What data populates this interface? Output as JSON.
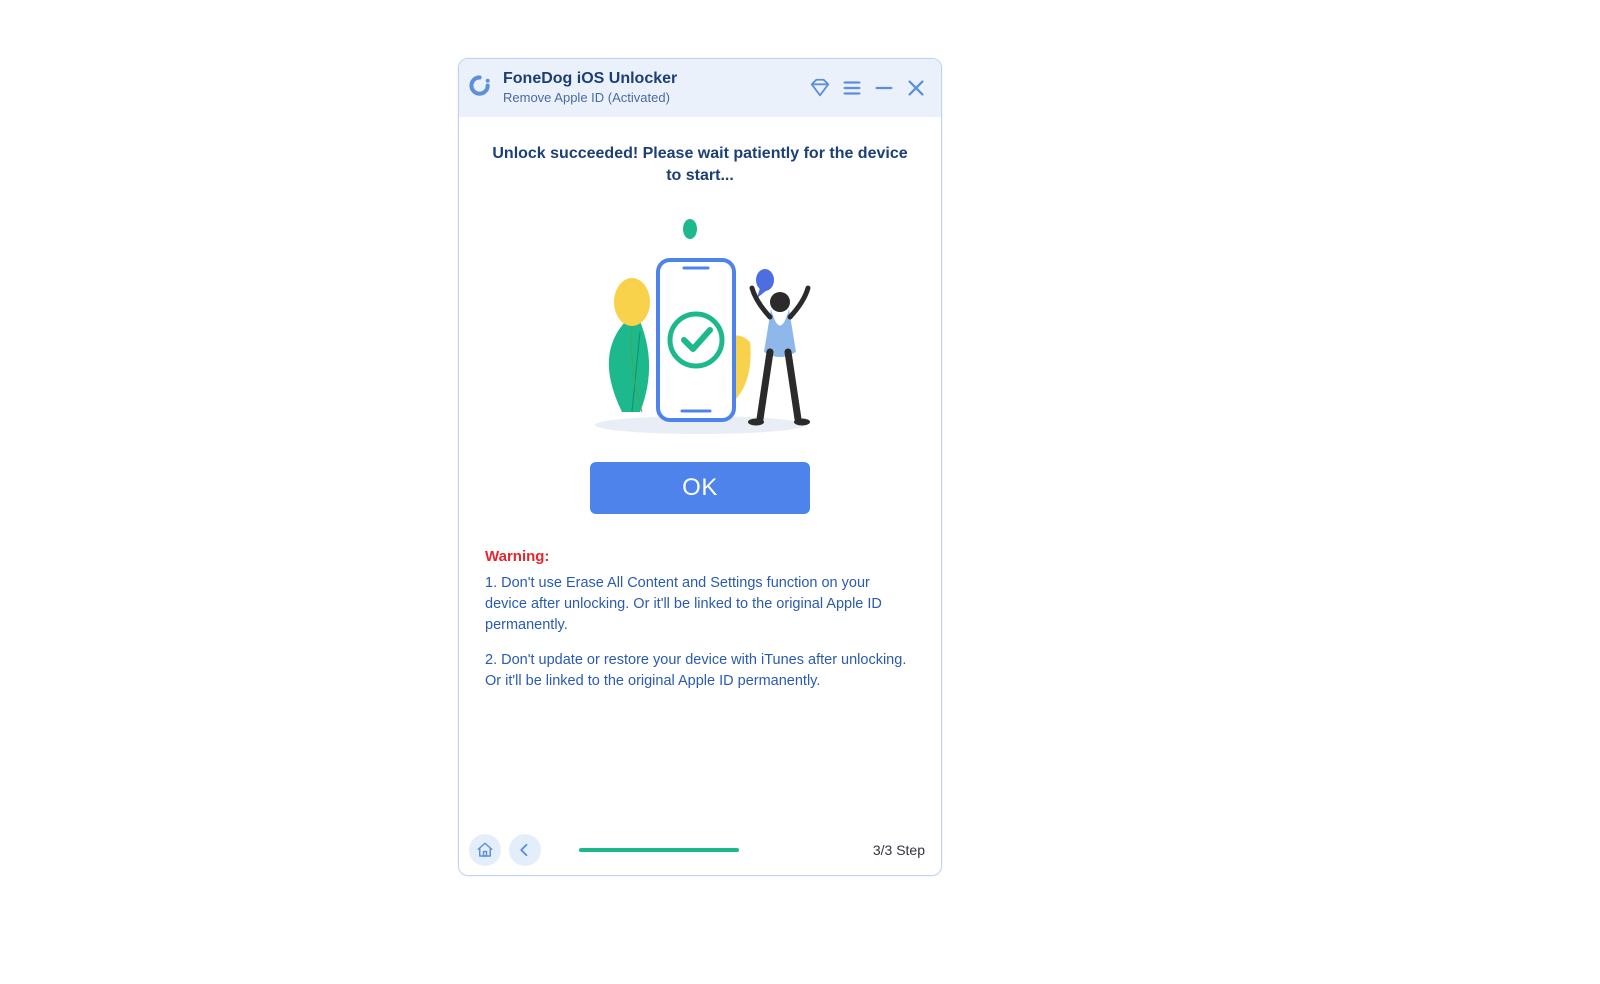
{
  "header": {
    "app_title": "FoneDog iOS Unlocker",
    "subtitle": "Remove Apple ID  (Activated)"
  },
  "main": {
    "headline": "Unlock succeeded! Please wait patiently for the device to start...",
    "ok_label": "OK",
    "warning_title": "Warning:",
    "warning_1": "1. Don't use Erase All Content and Settings function on your device after unlocking. Or it'll be linked to the original Apple ID permanently.",
    "warning_2": "2. Don't update or restore your device with iTunes after unlocking. Or it'll be linked to the original Apple ID permanently."
  },
  "footer": {
    "step_label": "3/3 Step",
    "progress_fraction": 0.58
  },
  "icons": {
    "logo": "fonedog-logo",
    "diamond": "diamond-icon",
    "menu": "menu-icon",
    "minimize": "minimize-icon",
    "close": "close-icon",
    "home": "home-icon",
    "back": "back-icon"
  },
  "colors": {
    "primary_blue": "#4d83ea",
    "dark_blue_text": "#1c3f74",
    "link_blue": "#2a5bb0",
    "warning_red": "#e4262f",
    "progress_green": "#1db88c",
    "header_bg": "#eaf1fb"
  }
}
